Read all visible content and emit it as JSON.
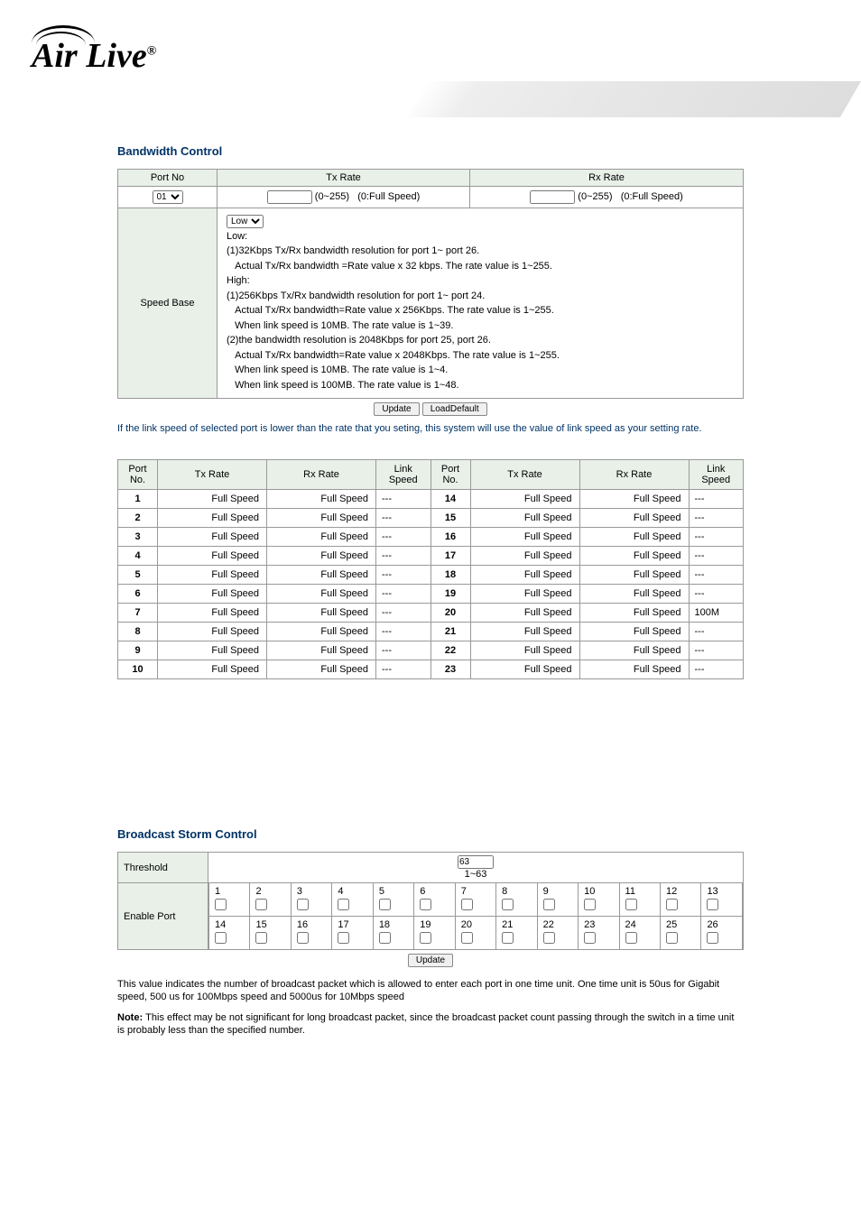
{
  "logo": "Air Live",
  "bw": {
    "title": "Bandwidth Control",
    "headers": {
      "portno": "Port No",
      "txrate": "Tx Rate",
      "rxrate": "Rx Rate"
    },
    "port_select": "01",
    "rate_range": "(0~255)",
    "rate_hint": "(0:Full Speed)",
    "speedbase_label": "Speed Base",
    "speed_select": "Low",
    "speed_text": {
      "low": "Low:",
      "l1": "(1)32Kbps Tx/Rx bandwidth resolution for port 1~ port 26.",
      "l2": "Actual Tx/Rx bandwidth =Rate value x 32 kbps. The rate value is 1~255.",
      "high": "High:",
      "h1": "(1)256Kbps Tx/Rx bandwidth resolution for port 1~ port 24.",
      "h2": "Actual Tx/Rx bandwidth=Rate value x 256Kbps. The rate value is 1~255.",
      "h3": "When link speed is 10MB. The rate value is 1~39.",
      "h4": "(2)the bandwidth resolution is 2048Kbps for port 25, port 26.",
      "h5": "Actual Tx/Rx bandwidth=Rate value x 2048Kbps. The rate value is 1~255.",
      "h6": "When link speed is 10MB. The rate value is 1~4.",
      "h7": "When link speed is 100MB. The rate value is 1~48."
    },
    "btn_update": "Update",
    "btn_load": "LoadDefault",
    "note": "If the link speed of selected port is lower than the rate that you seting, this system will use the value of link speed as your setting rate."
  },
  "ports": {
    "headers": {
      "no": "Port No.",
      "tx": "Tx  Rate",
      "rx": "Rx  Rate",
      "link": "Link Speed"
    },
    "rows_left": [
      {
        "no": "1",
        "tx": "Full Speed",
        "rx": "Full Speed",
        "link": "---"
      },
      {
        "no": "2",
        "tx": "Full Speed",
        "rx": "Full Speed",
        "link": "---"
      },
      {
        "no": "3",
        "tx": "Full Speed",
        "rx": "Full Speed",
        "link": "---"
      },
      {
        "no": "4",
        "tx": "Full Speed",
        "rx": "Full Speed",
        "link": "---"
      },
      {
        "no": "5",
        "tx": "Full Speed",
        "rx": "Full Speed",
        "link": "---"
      },
      {
        "no": "6",
        "tx": "Full Speed",
        "rx": "Full Speed",
        "link": "---"
      },
      {
        "no": "7",
        "tx": "Full Speed",
        "rx": "Full Speed",
        "link": "---"
      },
      {
        "no": "8",
        "tx": "Full Speed",
        "rx": "Full Speed",
        "link": "---"
      },
      {
        "no": "9",
        "tx": "Full Speed",
        "rx": "Full Speed",
        "link": "---"
      },
      {
        "no": "10",
        "tx": "Full Speed",
        "rx": "Full Speed",
        "link": "---"
      }
    ],
    "rows_right": [
      {
        "no": "14",
        "tx": "Full Speed",
        "rx": "Full Speed",
        "link": "---"
      },
      {
        "no": "15",
        "tx": "Full Speed",
        "rx": "Full Speed",
        "link": "---"
      },
      {
        "no": "16",
        "tx": "Full Speed",
        "rx": "Full Speed",
        "link": "---"
      },
      {
        "no": "17",
        "tx": "Full Speed",
        "rx": "Full Speed",
        "link": "---"
      },
      {
        "no": "18",
        "tx": "Full Speed",
        "rx": "Full Speed",
        "link": "---"
      },
      {
        "no": "19",
        "tx": "Full Speed",
        "rx": "Full Speed",
        "link": "---"
      },
      {
        "no": "20",
        "tx": "Full Speed",
        "rx": "Full Speed",
        "link": "100M"
      },
      {
        "no": "21",
        "tx": "Full Speed",
        "rx": "Full Speed",
        "link": "---"
      },
      {
        "no": "22",
        "tx": "Full Speed",
        "rx": "Full Speed",
        "link": "---"
      },
      {
        "no": "23",
        "tx": "Full Speed",
        "rx": "Full Speed",
        "link": "---"
      }
    ]
  },
  "storm": {
    "title": "Broadcast Storm Control",
    "threshold_label": "Threshold",
    "threshold_value": "63",
    "threshold_range": "1~63",
    "enable_label": "Enable Port",
    "btn_update": "Update",
    "ports_r1": [
      "1",
      "2",
      "3",
      "4",
      "5",
      "6",
      "7",
      "8",
      "9",
      "10",
      "11",
      "12",
      "13"
    ],
    "ports_r2": [
      "14",
      "15",
      "16",
      "17",
      "18",
      "19",
      "20",
      "21",
      "22",
      "23",
      "24",
      "25",
      "26"
    ],
    "note1": "This value indicates the number of broadcast packet which is allowed to enter each port in one time unit. One time unit is 50us for Gigabit speed, 500 us for 100Mbps speed and 5000us for 10Mbps speed",
    "note2a": "Note: ",
    "note2b": "This effect may be not significant for long broadcast packet, since the broadcast packet count passing through the switch in a time unit is probably less than the specified number."
  }
}
